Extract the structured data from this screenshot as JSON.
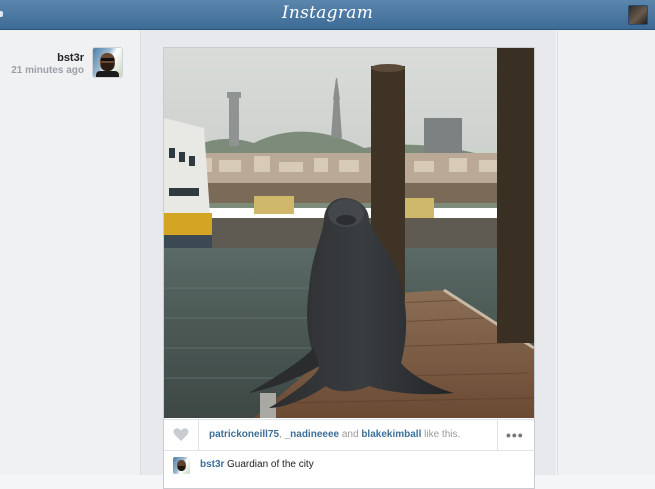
{
  "app": {
    "title": "Instagram"
  },
  "post": {
    "username": "bst3r",
    "time_ago": "21 minutes ago",
    "likes": {
      "likers": [
        "patrickoneill75",
        "_nadineeee",
        "blakekimball"
      ],
      "separator": ",",
      "conjunction": "and",
      "suffix": "like this."
    },
    "caption": {
      "username": "bst3r",
      "text": "Guardian of the city"
    },
    "more_label": "•••"
  },
  "colors": {
    "topbar": "#4a78a2",
    "link": "#3d6f98",
    "background": "#f0f1f3"
  },
  "icons": {
    "like": "heart-icon",
    "more": "ellipsis-icon"
  }
}
